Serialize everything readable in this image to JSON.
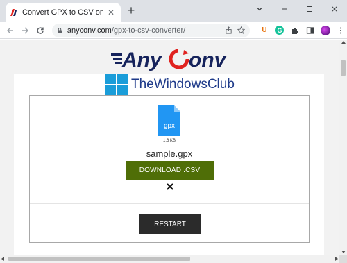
{
  "browser": {
    "tab_title": "Convert GPX to CSV online for free",
    "url_host": "anyconv.com",
    "url_path": "/gpx-to-csv-converter/",
    "extensions": {
      "u_label": "U",
      "g_label": "G"
    }
  },
  "site": {
    "logo_text": "AnyConv",
    "watermark_text": "TheWindowsClub"
  },
  "converter": {
    "file_ext_label": "gpx",
    "file_size": "1.6 KB",
    "file_name": "sample.gpx",
    "download_label": "DOWNLOAD .CSV",
    "restart_label": "RESTART"
  },
  "colors": {
    "download_button": "#4f6e07",
    "restart_button": "#2b2b2b",
    "file_icon": "#2196f3",
    "logo_navy": "#16235c",
    "logo_red": "#e0221f"
  }
}
